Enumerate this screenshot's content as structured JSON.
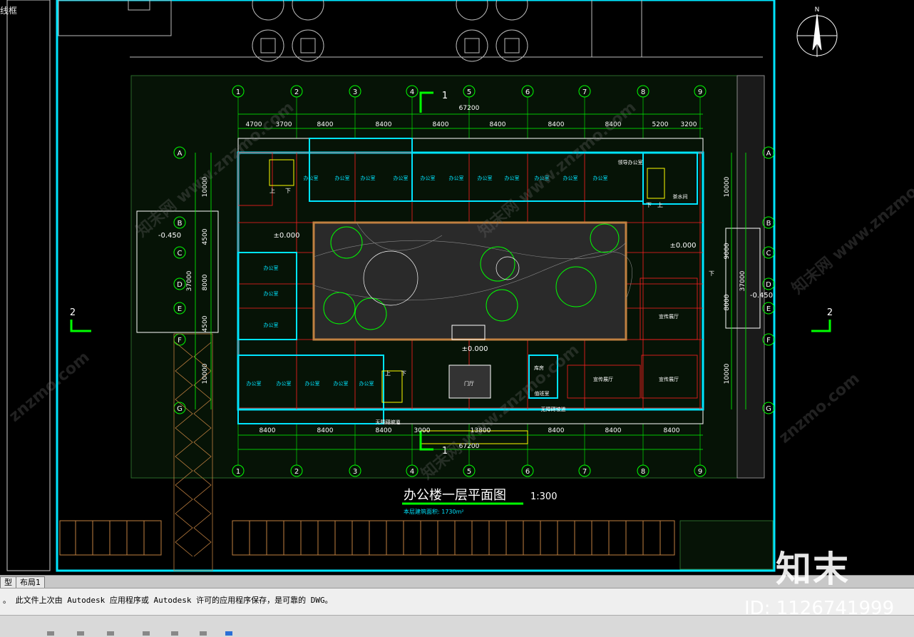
{
  "drawing": {
    "corner_label": "线框",
    "title": "办公楼一层平面图",
    "scale": "1:300",
    "area_note": "本层建筑面积: 1730m²",
    "compass_label": "N",
    "axes_cols": [
      "1",
      "2",
      "3",
      "4",
      "5",
      "6",
      "7",
      "8",
      "9"
    ],
    "axes_rows": [
      "A",
      "B",
      "C",
      "D",
      "E",
      "F",
      "G"
    ],
    "total_dim": "67200",
    "top_dims": [
      "4700",
      "3700",
      "8400",
      "8400",
      "8400",
      "8400",
      "8400",
      "8400",
      "5200",
      "3200"
    ],
    "bottom_dims": [
      "8400",
      "8400",
      "8400",
      "3000",
      "13800",
      "8400",
      "8400",
      "8400"
    ],
    "left_dims": [
      "10000",
      "4500",
      "8000",
      "4500",
      "10000"
    ],
    "left_total": "37000",
    "right_dims": [
      "10000",
      "9000",
      "8000",
      "10000"
    ],
    "right_total": "37000",
    "section_marks": [
      "1",
      "2"
    ],
    "levels": [
      "-0.450",
      "±0.000",
      "±0.000",
      "±0.000",
      "-0.450"
    ],
    "room_labels": [
      "办公室",
      "宣传展厅",
      "门厅",
      "库房",
      "值班室",
      "领导办公室",
      "茶水间",
      "无障碍坡道"
    ],
    "stair_labels": [
      "上",
      "下"
    ]
  },
  "tabs": [
    "型",
    "布局1"
  ],
  "command_line": "。  此文件上次由 Autodesk 应用程序或 Autodesk 许可的应用程序保存，是可靠的 DWG。",
  "watermark": {
    "brand": "知末",
    "id": "ID: 1126741999",
    "site": "znzmo.com",
    "site_cn": "知末网 www.znzmo.com"
  },
  "colors": {
    "cyan": "#00e5ff",
    "green": "#00ff00",
    "red": "#ff2020",
    "white": "#ffffff",
    "orange": "#c08040"
  }
}
